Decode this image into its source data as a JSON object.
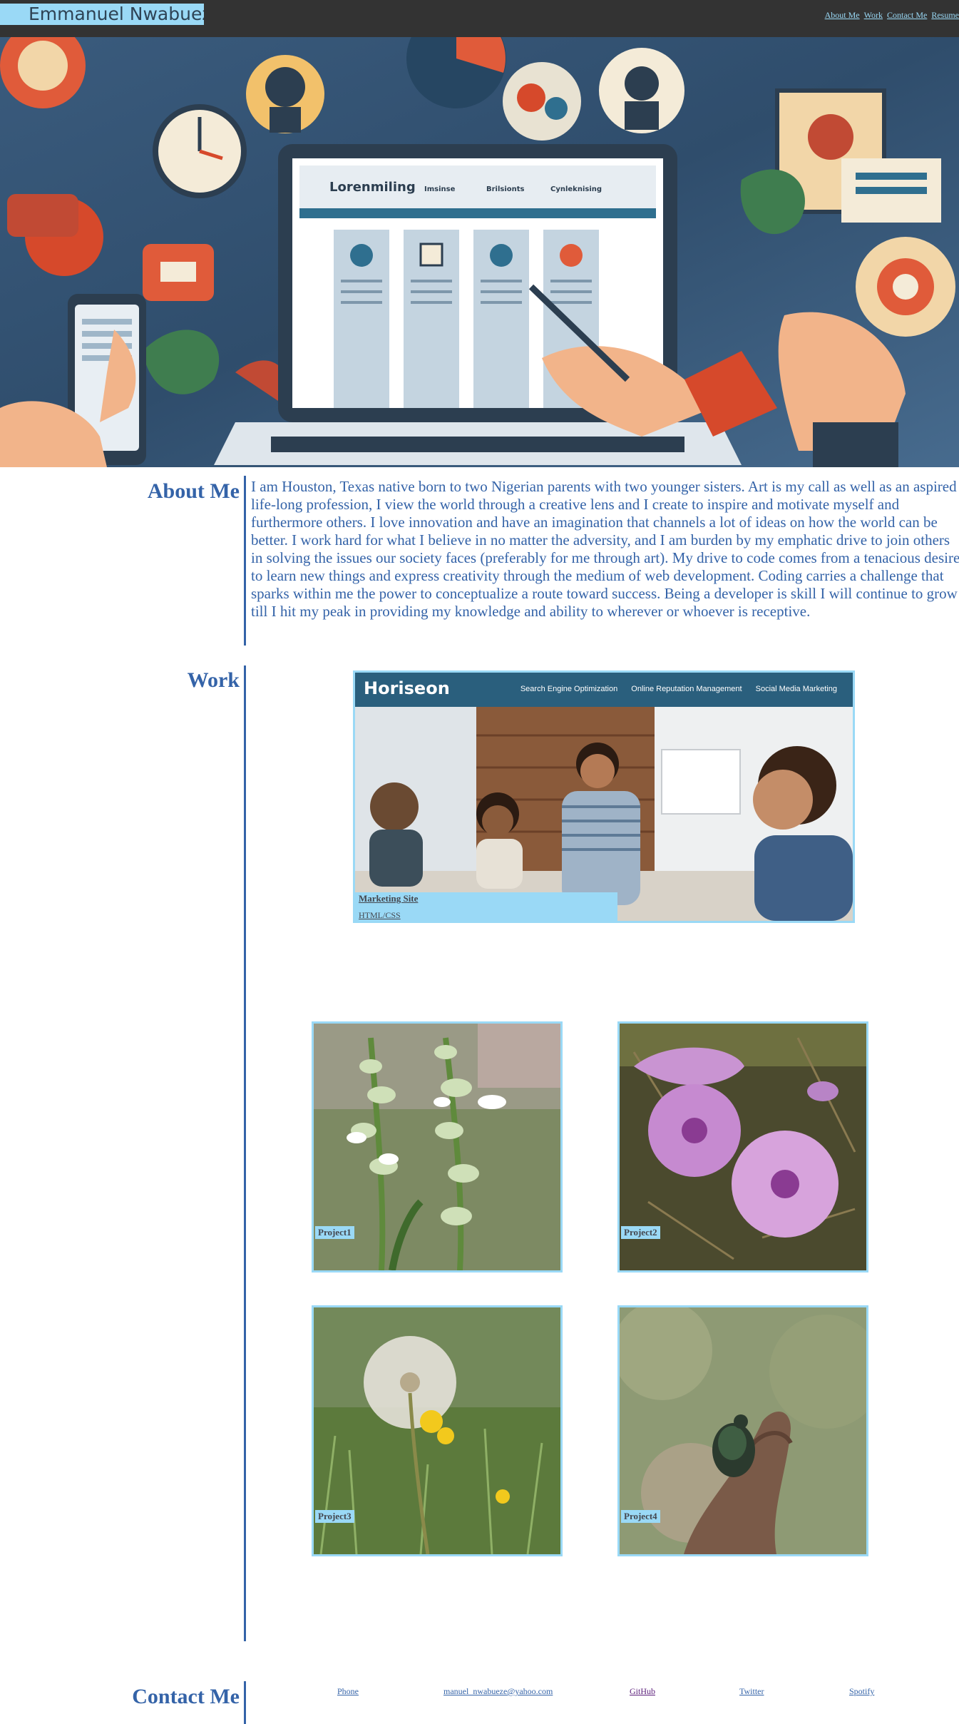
{
  "header": {
    "brand": "Emmanuel Nwabueze",
    "nav": [
      "About Me",
      "Work",
      "Contact Me",
      "Resume"
    ]
  },
  "hero": {
    "alt": "Illustration of a laptop surrounded by tech, people and nature icons",
    "screen_title": "Lorenmiling",
    "screen_tabs": [
      "Imsinse",
      "Brilsionts",
      "Cynleknising"
    ]
  },
  "about": {
    "title": "About Me",
    "text": "I am Houston, Texas native born to two Nigerian parents with two younger sisters. Art is my call as well as an aspired life-long profession, I view the world through a creative lens and I create to inspire and motivate myself and furthermore others. I love innovation and have an imagination that channels a lot of ideas on how the world can be better. I work hard for what I believe in no matter the adversity, and I am burden by my emphatic drive to join others in solving the issues our society faces (preferably for me through art). My drive to code comes from a tenacious desire to learn new things and express creativity through the medium of web development. Coding carries a challenge that sparks within me the power to conceptualize a route toward success. Being a developer is skill I will continue to grow till I hit my peak in providing my knowledge and ability to wherever or whoever is receptive."
  },
  "work": {
    "title": "Work",
    "featured": {
      "site_logo": "Horiseon",
      "site_links": [
        "Search Engine Optimization",
        "Online Reputation Management",
        "Social Media Marketing"
      ],
      "caption_title": "Marketing Site",
      "caption_sub": "HTML/CSS"
    },
    "projects": [
      {
        "label": "Project1"
      },
      {
        "label": "Project2"
      },
      {
        "label": "Project3"
      },
      {
        "label": "Project4"
      }
    ]
  },
  "contact": {
    "title": "Contact Me",
    "links": [
      "Phone",
      "manuel_nwabueze@yahoo.com",
      "GitHub",
      "Twitter",
      "Spotify"
    ]
  },
  "colors": {
    "header_bg": "#333333",
    "accent_light_blue": "#9ad9f6",
    "text_blue": "#3463a8"
  }
}
